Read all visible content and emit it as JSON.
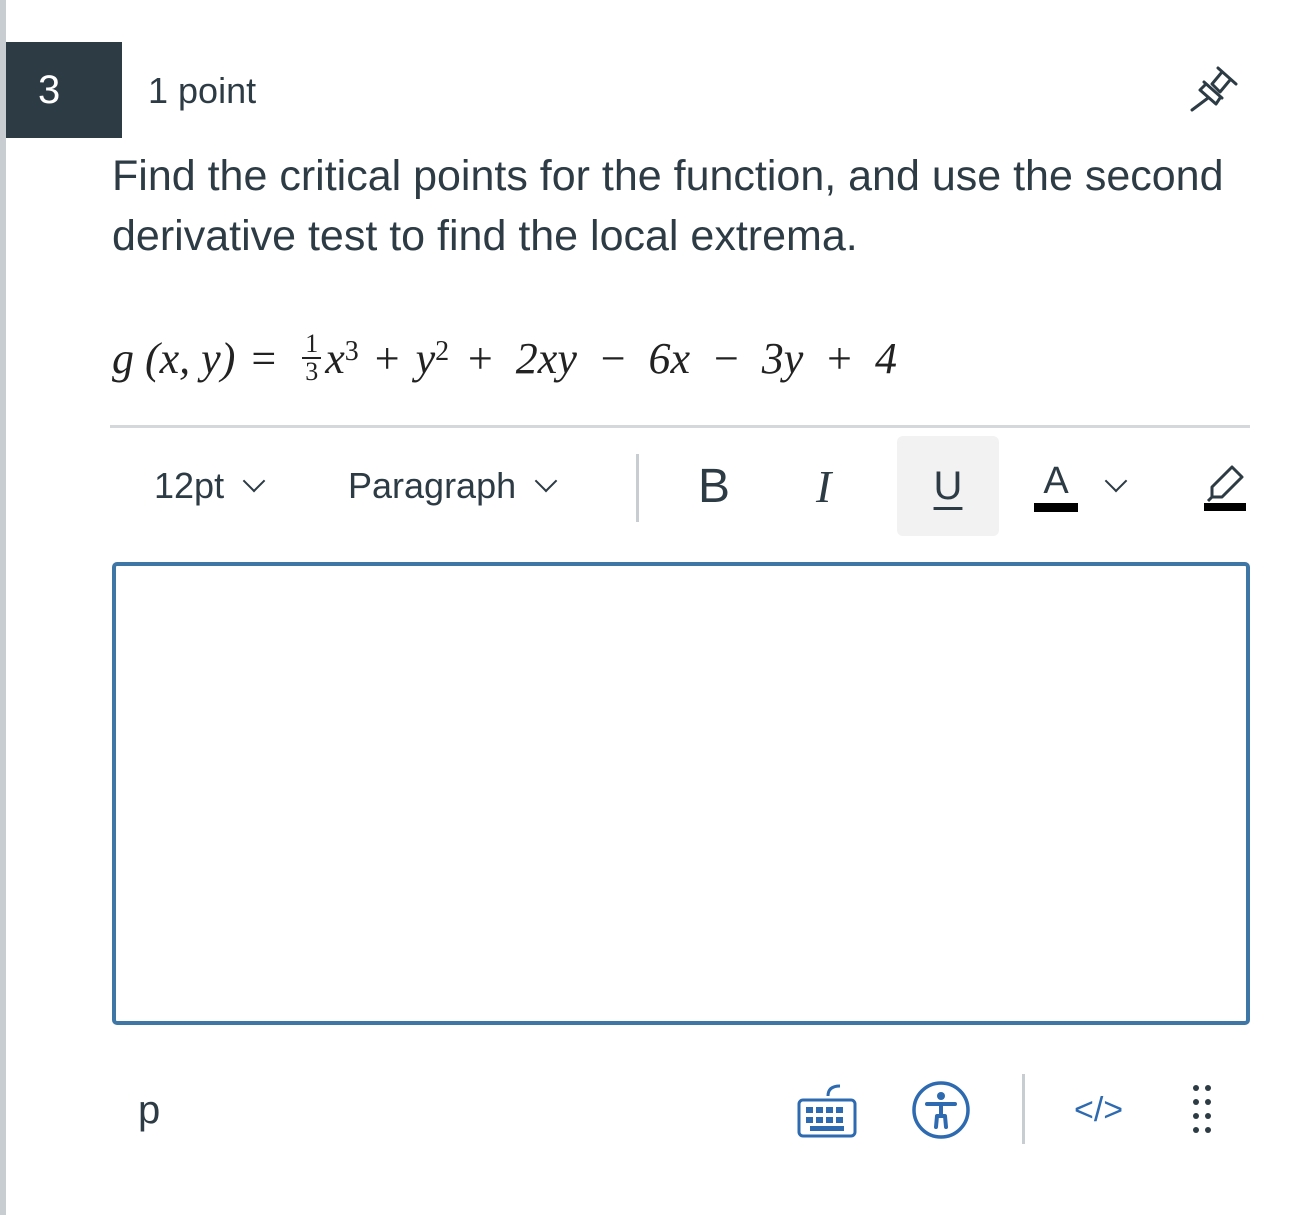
{
  "question": {
    "number": "3",
    "points": "1 point",
    "text": "Find the critical points for the function, and use the second derivative test to find the local extrema."
  },
  "formula": {
    "lhs": "g (x, y)",
    "equals": "=",
    "frac_num": "1",
    "frac_den": "3",
    "t1": "x",
    "t1_exp": "3",
    "plus1": "+",
    "t2": "y",
    "t2_exp": "2",
    "rest": "+ 2xy − 6x − 3y + 4"
  },
  "toolbar": {
    "font_size": "12pt",
    "block_format": "Paragraph",
    "bold": "B",
    "italic": "I",
    "underline": "U",
    "text_color": "A"
  },
  "editor": {
    "content": ""
  },
  "statusbar": {
    "path": "p",
    "html_toggle": "</>"
  },
  "colors": {
    "dark": "#2d3b45",
    "editor_border": "#3e76a6",
    "link": "#2d6ab0"
  },
  "icons": [
    "pin-icon",
    "chevron-down-icon",
    "highlight-icon",
    "keyboard-icon",
    "accessibility-icon",
    "more-vertical-icon"
  ]
}
